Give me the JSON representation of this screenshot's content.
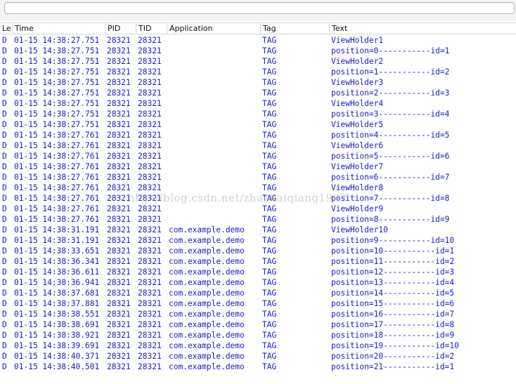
{
  "filter": {
    "value": "",
    "placeholder": ""
  },
  "columns": {
    "level": "Le",
    "time": "Time",
    "pid": "PID",
    "tid": "TID",
    "application": "Application",
    "tag": "Tag",
    "text": "Text"
  },
  "colors": {
    "log_text": "#1b1bc8"
  },
  "watermark": "http://blog.csdn.net/zhaokaiqiang1992",
  "rows": [
    {
      "level": "D",
      "time": "01-15 14:38:27.751",
      "pid": "28321",
      "tid": "28321",
      "app": "",
      "tag": "TAG",
      "text": "ViewHolder1"
    },
    {
      "level": "D",
      "time": "01-15 14:38:27.751",
      "pid": "28321",
      "tid": "28321",
      "app": "",
      "tag": "TAG",
      "text": "position=0-----------id=1"
    },
    {
      "level": "D",
      "time": "01-15 14:38:27.751",
      "pid": "28321",
      "tid": "28321",
      "app": "",
      "tag": "TAG",
      "text": "ViewHolder2"
    },
    {
      "level": "D",
      "time": "01-15 14:38:27.751",
      "pid": "28321",
      "tid": "28321",
      "app": "",
      "tag": "TAG",
      "text": "position=1-----------id=2"
    },
    {
      "level": "D",
      "time": "01-15 14:38:27.751",
      "pid": "28321",
      "tid": "28321",
      "app": "",
      "tag": "TAG",
      "text": "ViewHolder3"
    },
    {
      "level": "D",
      "time": "01-15 14:38:27.751",
      "pid": "28321",
      "tid": "28321",
      "app": "",
      "tag": "TAG",
      "text": "position=2-----------id=3"
    },
    {
      "level": "D",
      "time": "01-15 14:38:27.751",
      "pid": "28321",
      "tid": "28321",
      "app": "",
      "tag": "TAG",
      "text": "ViewHolder4"
    },
    {
      "level": "D",
      "time": "01-15 14:38:27.751",
      "pid": "28321",
      "tid": "28321",
      "app": "",
      "tag": "TAG",
      "text": "position=3-----------id=4"
    },
    {
      "level": "D",
      "time": "01-15 14:38:27.751",
      "pid": "28321",
      "tid": "28321",
      "app": "",
      "tag": "TAG",
      "text": "ViewHolder5"
    },
    {
      "level": "D",
      "time": "01-15 14:38:27.761",
      "pid": "28321",
      "tid": "28321",
      "app": "",
      "tag": "TAG",
      "text": "position=4-----------id=5"
    },
    {
      "level": "D",
      "time": "01-15 14:38:27.761",
      "pid": "28321",
      "tid": "28321",
      "app": "",
      "tag": "TAG",
      "text": "ViewHolder6"
    },
    {
      "level": "D",
      "time": "01-15 14:38:27.761",
      "pid": "28321",
      "tid": "28321",
      "app": "",
      "tag": "TAG",
      "text": "position=5-----------id=6"
    },
    {
      "level": "D",
      "time": "01-15 14:38:27.761",
      "pid": "28321",
      "tid": "28321",
      "app": "",
      "tag": "TAG",
      "text": "ViewHolder7"
    },
    {
      "level": "D",
      "time": "01-15 14:38:27.761",
      "pid": "28321",
      "tid": "28321",
      "app": "",
      "tag": "TAG",
      "text": "position=6-----------id=7"
    },
    {
      "level": "D",
      "time": "01-15 14:38:27.761",
      "pid": "28321",
      "tid": "28321",
      "app": "",
      "tag": "TAG",
      "text": "ViewHolder8"
    },
    {
      "level": "D",
      "time": "01-15 14:38:27.761",
      "pid": "28321",
      "tid": "28321",
      "app": "",
      "tag": "TAG",
      "text": "position=7-----------id=8"
    },
    {
      "level": "D",
      "time": "01-15 14:38:27.761",
      "pid": "28321",
      "tid": "28321",
      "app": "",
      "tag": "TAG",
      "text": "ViewHolder9"
    },
    {
      "level": "D",
      "time": "01-15 14:38:27.761",
      "pid": "28321",
      "tid": "28321",
      "app": "",
      "tag": "TAG",
      "text": "position=8-----------id=9"
    },
    {
      "level": "D",
      "time": "01-15 14:38:31.191",
      "pid": "28321",
      "tid": "28321",
      "app": "com.example.demo",
      "tag": "TAG",
      "text": "ViewHolder10"
    },
    {
      "level": "D",
      "time": "01-15 14:38:31.191",
      "pid": "28321",
      "tid": "28321",
      "app": "com.example.demo",
      "tag": "TAG",
      "text": "position=9-----------id=10"
    },
    {
      "level": "D",
      "time": "01-15 14:38:33.651",
      "pid": "28321",
      "tid": "28321",
      "app": "com.example.demo",
      "tag": "TAG",
      "text": "position=10-----------id=1"
    },
    {
      "level": "D",
      "time": "01-15 14:38:36.341",
      "pid": "28321",
      "tid": "28321",
      "app": "com.example.demo",
      "tag": "TAG",
      "text": "position=11-----------id=2"
    },
    {
      "level": "D",
      "time": "01-15 14:38:36.611",
      "pid": "28321",
      "tid": "28321",
      "app": "com.example.demo",
      "tag": "TAG",
      "text": "position=12-----------id=3"
    },
    {
      "level": "D",
      "time": "01-15 14:38:36.941",
      "pid": "28321",
      "tid": "28321",
      "app": "com.example.demo",
      "tag": "TAG",
      "text": "position=13-----------id=4"
    },
    {
      "level": "D",
      "time": "01-15 14:38:37.681",
      "pid": "28321",
      "tid": "28321",
      "app": "com.example.demo",
      "tag": "TAG",
      "text": "position=14-----------id=5"
    },
    {
      "level": "D",
      "time": "01-15 14:38:37.881",
      "pid": "28321",
      "tid": "28321",
      "app": "com.example.demo",
      "tag": "TAG",
      "text": "position=15-----------id=6"
    },
    {
      "level": "D",
      "time": "01-15 14:38:38.551",
      "pid": "28321",
      "tid": "28321",
      "app": "com.example.demo",
      "tag": "TAG",
      "text": "position=16-----------id=7"
    },
    {
      "level": "D",
      "time": "01-15 14:38:38.691",
      "pid": "28321",
      "tid": "28321",
      "app": "com.example.demo",
      "tag": "TAG",
      "text": "position=17-----------id=8"
    },
    {
      "level": "D",
      "time": "01-15 14:38:38.921",
      "pid": "28321",
      "tid": "28321",
      "app": "com.example.demo",
      "tag": "TAG",
      "text": "position=18-----------id=9"
    },
    {
      "level": "D",
      "time": "01-15 14:38:39.691",
      "pid": "28321",
      "tid": "28321",
      "app": "com.example.demo",
      "tag": "TAG",
      "text": "position=19-----------id=10"
    },
    {
      "level": "D",
      "time": "01-15 14:38:40.371",
      "pid": "28321",
      "tid": "28321",
      "app": "com.example.demo",
      "tag": "TAG",
      "text": "position=20-----------id=2"
    },
    {
      "level": "D",
      "time": "01-15 14:38:40.501",
      "pid": "28321",
      "tid": "28321",
      "app": "com.example.demo",
      "tag": "TAG",
      "text": "position=21-----------id=1"
    }
  ]
}
